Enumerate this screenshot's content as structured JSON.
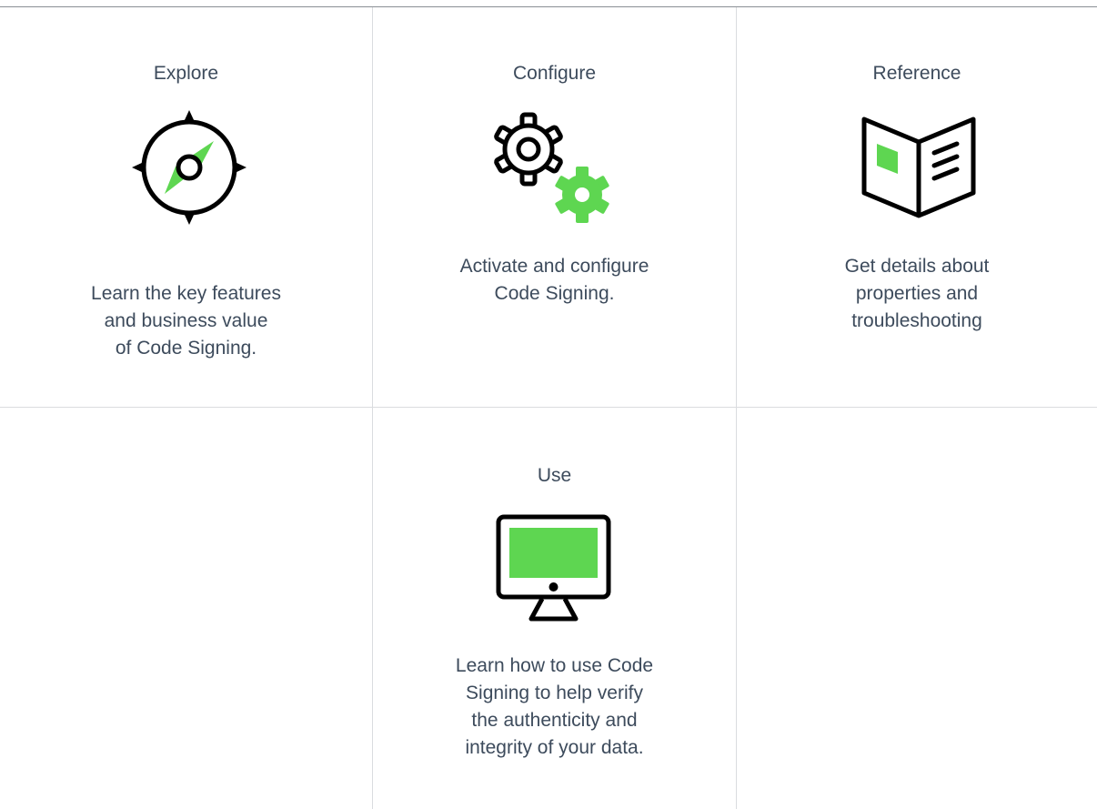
{
  "cards": [
    {
      "title": "Explore",
      "icon": "compass-icon",
      "desc": [
        "Learn the key features",
        "and business value",
        "of Code Signing."
      ]
    },
    {
      "title": "Configure",
      "icon": "gears-icon",
      "desc": [
        "Activate and configure",
        "Code Signing."
      ]
    },
    {
      "title": "Reference",
      "icon": "open-book-icon",
      "desc": [
        "Get details about",
        "properties and",
        "troubleshooting"
      ]
    },
    {
      "title": "Use",
      "icon": "monitor-icon",
      "desc": [
        "Learn how to use Code",
        "Signing to help verify",
        "the authenticity and",
        "integrity of your data."
      ]
    }
  ],
  "colors": {
    "accent": "#5ed651",
    "text": "#3d4b5c",
    "divider": "#dadcdf",
    "icon_stroke": "#000000"
  }
}
